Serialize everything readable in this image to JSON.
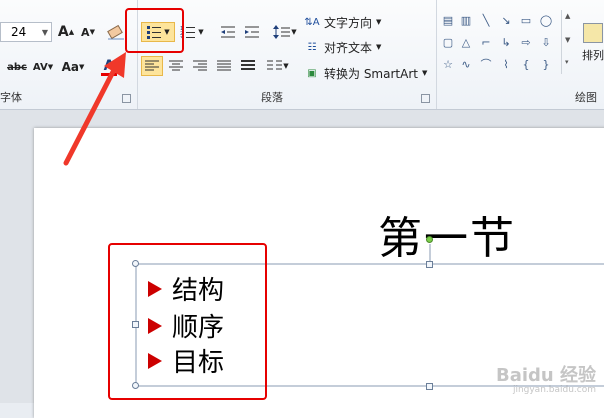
{
  "ribbon": {
    "font_group": {
      "label": "字体",
      "font_size": "24",
      "grow_label": "A",
      "shrink_label": "A",
      "strike_label": "abc",
      "spacing_label": "AV",
      "case_label": "Aa",
      "color_label": "A"
    },
    "paragraph_group": {
      "label": "段落",
      "text_direction": "文字方向",
      "align_text": "对齐文本",
      "smartart": "转换为 SmartArt"
    },
    "drawing_group": {
      "label": "绘图",
      "arrange": "排列"
    }
  },
  "slide": {
    "title": "第一节",
    "bullets": [
      "结构",
      "顺序",
      "目标"
    ]
  },
  "watermark": {
    "brand": "Baidu 经验",
    "sub": "jingyan.baidu.com"
  },
  "colors": {
    "annotation_red": "#e60000",
    "bullet_red": "#cc0000",
    "active_button": "#fde49b"
  }
}
